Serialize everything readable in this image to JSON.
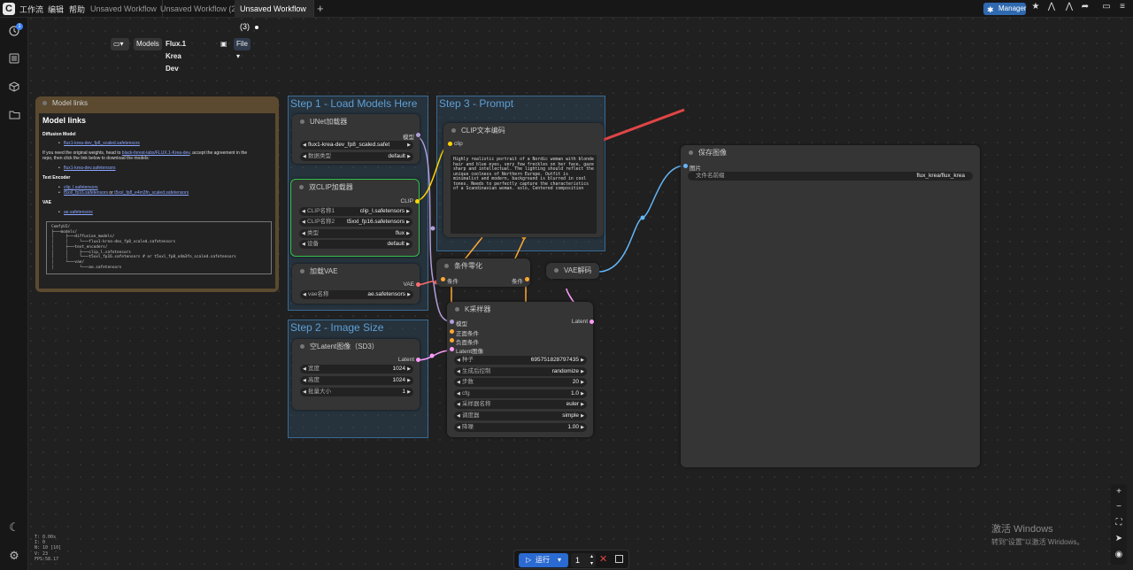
{
  "topbar": {
    "logo": "C",
    "menu": [
      "工作流",
      "编辑",
      "帮助"
    ],
    "tabs": [
      "Unsaved Workflow",
      "Unsaved Workflow (2)",
      "Unsaved Workflow (3)"
    ],
    "add_tab": "+",
    "manager_label": "Manager"
  },
  "sidebar": {
    "badge_count": "1"
  },
  "modelbar": {
    "models_label": "Models",
    "title": "Flux.1 Krea Dev",
    "file_label": "File"
  },
  "groups": {
    "step1": "Step 1 - Load Models Here",
    "step2": "Step 2 - Image Size",
    "step3": "Step 3 - Prompt"
  },
  "note": {
    "header": "Model links",
    "title": "Model links",
    "diffusion_heading": "Diffusion Model",
    "diffusion_link": "flux1-krea-dev_fp8_scaled.safetensors",
    "info_line1_pre": "If you need the original weights, head to ",
    "info_line1_link": "black-forest-labs/FLUX.1-Krea-dev",
    "info_line1_post": ", accept the agreement in the",
    "info_line2": "repo, then click the link below to download the models:",
    "original_link": "flux1-krea-dev.safetensors",
    "text_encoder_heading": "Text Encoder",
    "te_link1": "clip_l.safetensors",
    "te_link2": "t5xxl_fp16.safetensors",
    "te_or": " or ",
    "te_link3": "t5xxl_fp8_e4m3fn_scaled.safetensors",
    "vae_heading": "VAE",
    "vae_link": "ae.safetensors",
    "tree": "ComfyUI/\n├───models/\n│     ├───diffusion_models/\n│     │     └───flux1-krea-dev_fp8_scaled.safetensors\n│     ├───text_encoders/\n│     │     ├───clip_l.safetensors\n│     │     └───t5xxl_fp16.safetensors # or t5xxl_fp8_e4m3fn_scaled.safetensors\n│     └───vae/\n│           └───ae.safetensors"
  },
  "unet": {
    "title": "UNet加载器",
    "out": "模型",
    "unet_name_value": "flux1-krea-dev_fp8_scaled.safet",
    "dtype_label": "数据类型",
    "dtype_value": "default"
  },
  "dualclip": {
    "title": "双CLIP加载器",
    "out": "CLIP",
    "clip1_label": "CLIP名称1",
    "clip1_value": "clip_l.safetensors",
    "clip2_label": "CLIP名称2",
    "clip2_value": "t5xxl_fp16.safetensors",
    "type_label": "类型",
    "type_value": "flux",
    "device_label": "设备",
    "device_value": "default"
  },
  "vaeloader": {
    "title": "加载VAE",
    "out": "VAE",
    "vae_label": "vae名称",
    "vae_value": "ae.safetensors"
  },
  "latent": {
    "title": "空Latent图像（SD3）",
    "out": "Latent",
    "width_label": "宽度",
    "width_value": "1024",
    "height_label": "高度",
    "height_value": "1024",
    "batch_label": "批量大小",
    "batch_value": "1"
  },
  "clipencode": {
    "title": "CLIP文本编码",
    "in": "clip",
    "prompt": "Highly realistic portrait of a Nordic woman with blonde hair and blue eyes, very few freckles on her face, gaze sharp and intellectual. The lighting should reflect the unique coolness of Northern Europe. Outfit is minimalist and modern, background is blurred in cool tones. Needs to perfectly capture the characteristics of a Scandinavian woman. solo, Centered composition"
  },
  "zeroout": {
    "title": "条件零化",
    "in": "条件",
    "out": "条件"
  },
  "vaedecode": {
    "title": "VAE解码"
  },
  "ksampler": {
    "title": "K采样器",
    "in_model": "模型",
    "in_pos": "正面条件",
    "in_neg": "负面条件",
    "in_latent": "Latent图像",
    "out": "Latent",
    "seed_label": "种子",
    "seed_value": "695751828797435",
    "control_label": "生成后控制",
    "control_value": "randomize",
    "steps_label": "步数",
    "steps_value": "20",
    "cfg_label": "cfg",
    "cfg_value": "1.0",
    "sampler_label": "采样器名称",
    "sampler_value": "euler",
    "scheduler_label": "调度器",
    "scheduler_value": "simple",
    "denoise_label": "降噪",
    "denoise_value": "1.00"
  },
  "saveimage": {
    "title": "保存图像",
    "in": "图片",
    "prefix_label": "文件名前缀",
    "prefix_value": "flux_krea/flux_krea"
  },
  "stats": {
    "t": "T: 0.00s",
    "i": "I: 0",
    "n": "N: 10 [10]",
    "v": "V: 23",
    "fps": "FPS:58.17"
  },
  "runbar": {
    "run_label": "运行",
    "count": "1"
  },
  "watermark": {
    "line1": "激活 Windows",
    "line2": "转到\"设置\"以激活 Windows。"
  },
  "colors": {
    "accent": "#2b6ad1",
    "group": "#3d74a0",
    "note": "#5b4a2f",
    "clip": "#ffd500",
    "vae": "#ff6e6e",
    "latent": "#ff9cf9",
    "model": "#b39ddb",
    "image": "#64b5f6",
    "conditioning": "#ffa931"
  }
}
